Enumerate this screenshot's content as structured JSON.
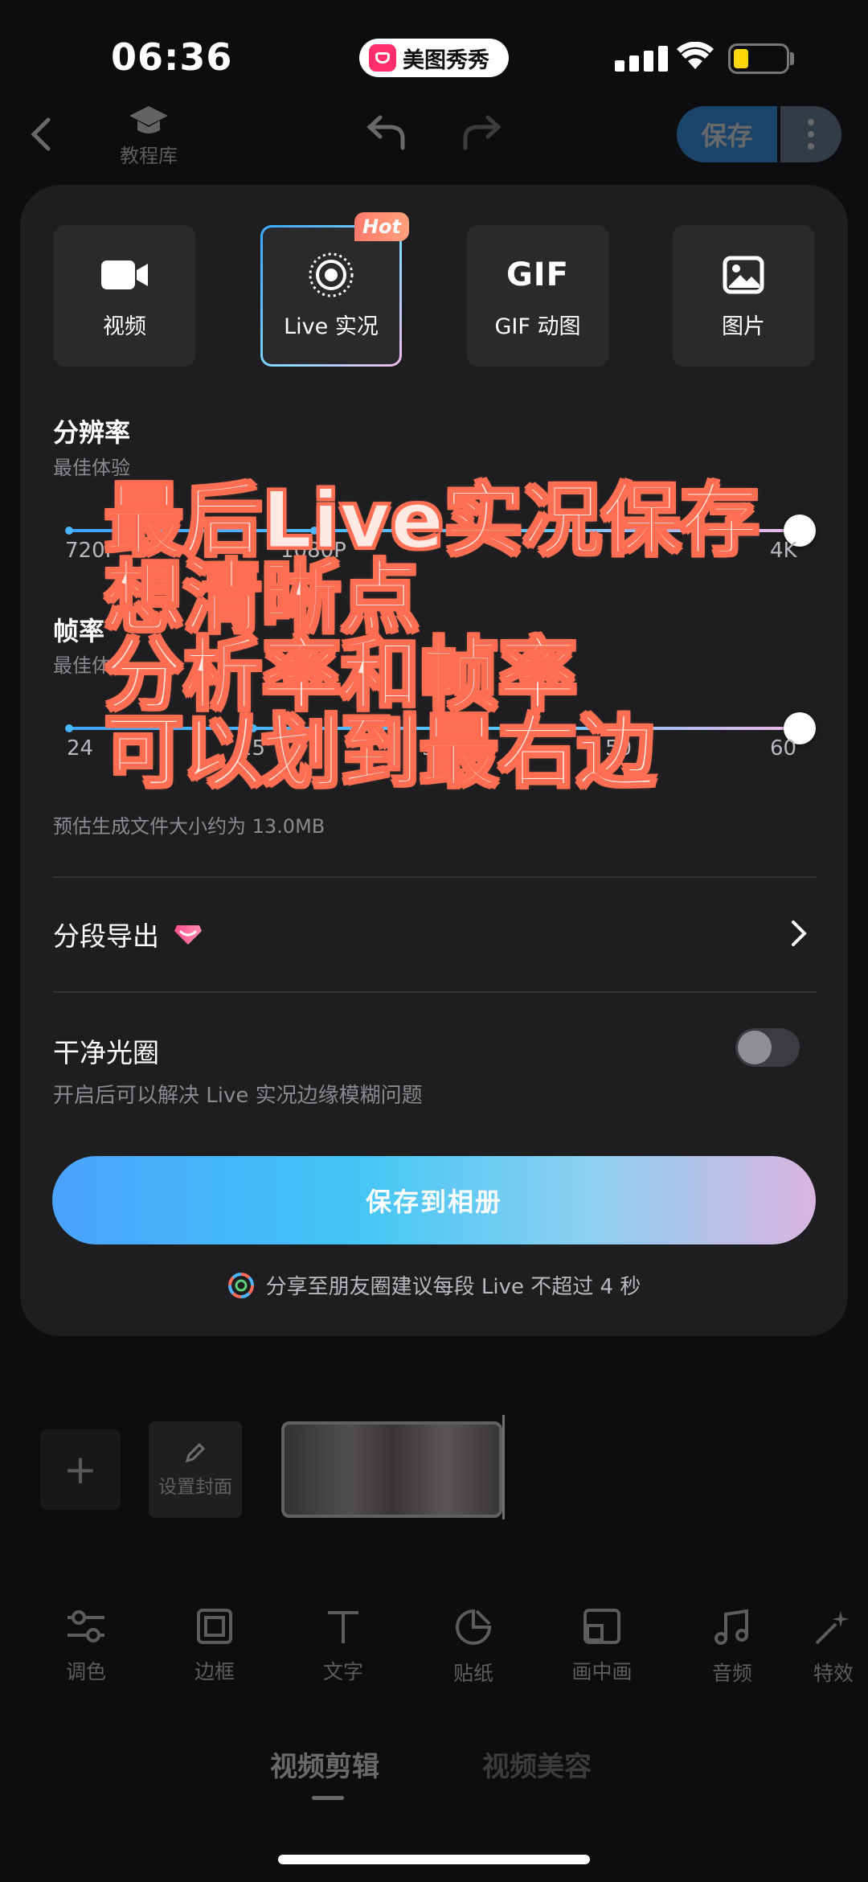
{
  "status_bar": {
    "time": "06:36",
    "app_pill": "美图秀秀"
  },
  "top_bar": {
    "tutorial_label": "教程库",
    "save_label": "保存"
  },
  "export_panel": {
    "formats": [
      {
        "label": "视频",
        "icon": "video-camera-icon",
        "selected": false
      },
      {
        "label": "Live 实况",
        "icon": "live-photo-icon",
        "selected": true,
        "badge": "Hot"
      },
      {
        "label": "GIF 动图",
        "icon": "gif-icon",
        "icon_text": "GIF",
        "selected": false
      },
      {
        "label": "图片",
        "icon": "image-icon",
        "selected": false
      }
    ],
    "resolution": {
      "title": "分辨率",
      "subtitle": "最佳体验",
      "ticks": [
        "720P",
        "1080P",
        "",
        "4K"
      ],
      "value": "4K"
    },
    "frame_rate": {
      "title": "帧率",
      "subtitle": "最佳体验",
      "ticks": [
        "24",
        "25",
        "30",
        "50",
        "60"
      ],
      "value": "60"
    },
    "estimate": "预估生成文件大小约为 13.0MB",
    "segment_export": {
      "label": "分段导出"
    },
    "clean_halo": {
      "label": "干净光圈",
      "description": "开启后可以解决 Live 实况边缘模糊问题",
      "enabled": false
    },
    "save_button": "保存到相册",
    "tip": "分享至朋友圈建议每段 Live 不超过 4 秒"
  },
  "overlay_caption": [
    "最后Live实况保存",
    "想清晰点",
    "分析率和帧率",
    "可以划到最右边"
  ],
  "timeline": {
    "cover_label": "设置封面"
  },
  "toolbar": [
    "调色",
    "边框",
    "文字",
    "贴纸",
    "画中画",
    "音频",
    "特效"
  ],
  "bottom_tabs": [
    "视频剪辑",
    "视频美容"
  ],
  "colors": {
    "accent": "#3da4ff",
    "panel": "#1e1e20",
    "caption_stroke": "#ff6d52",
    "hot_badge": "#ff7a6a"
  }
}
